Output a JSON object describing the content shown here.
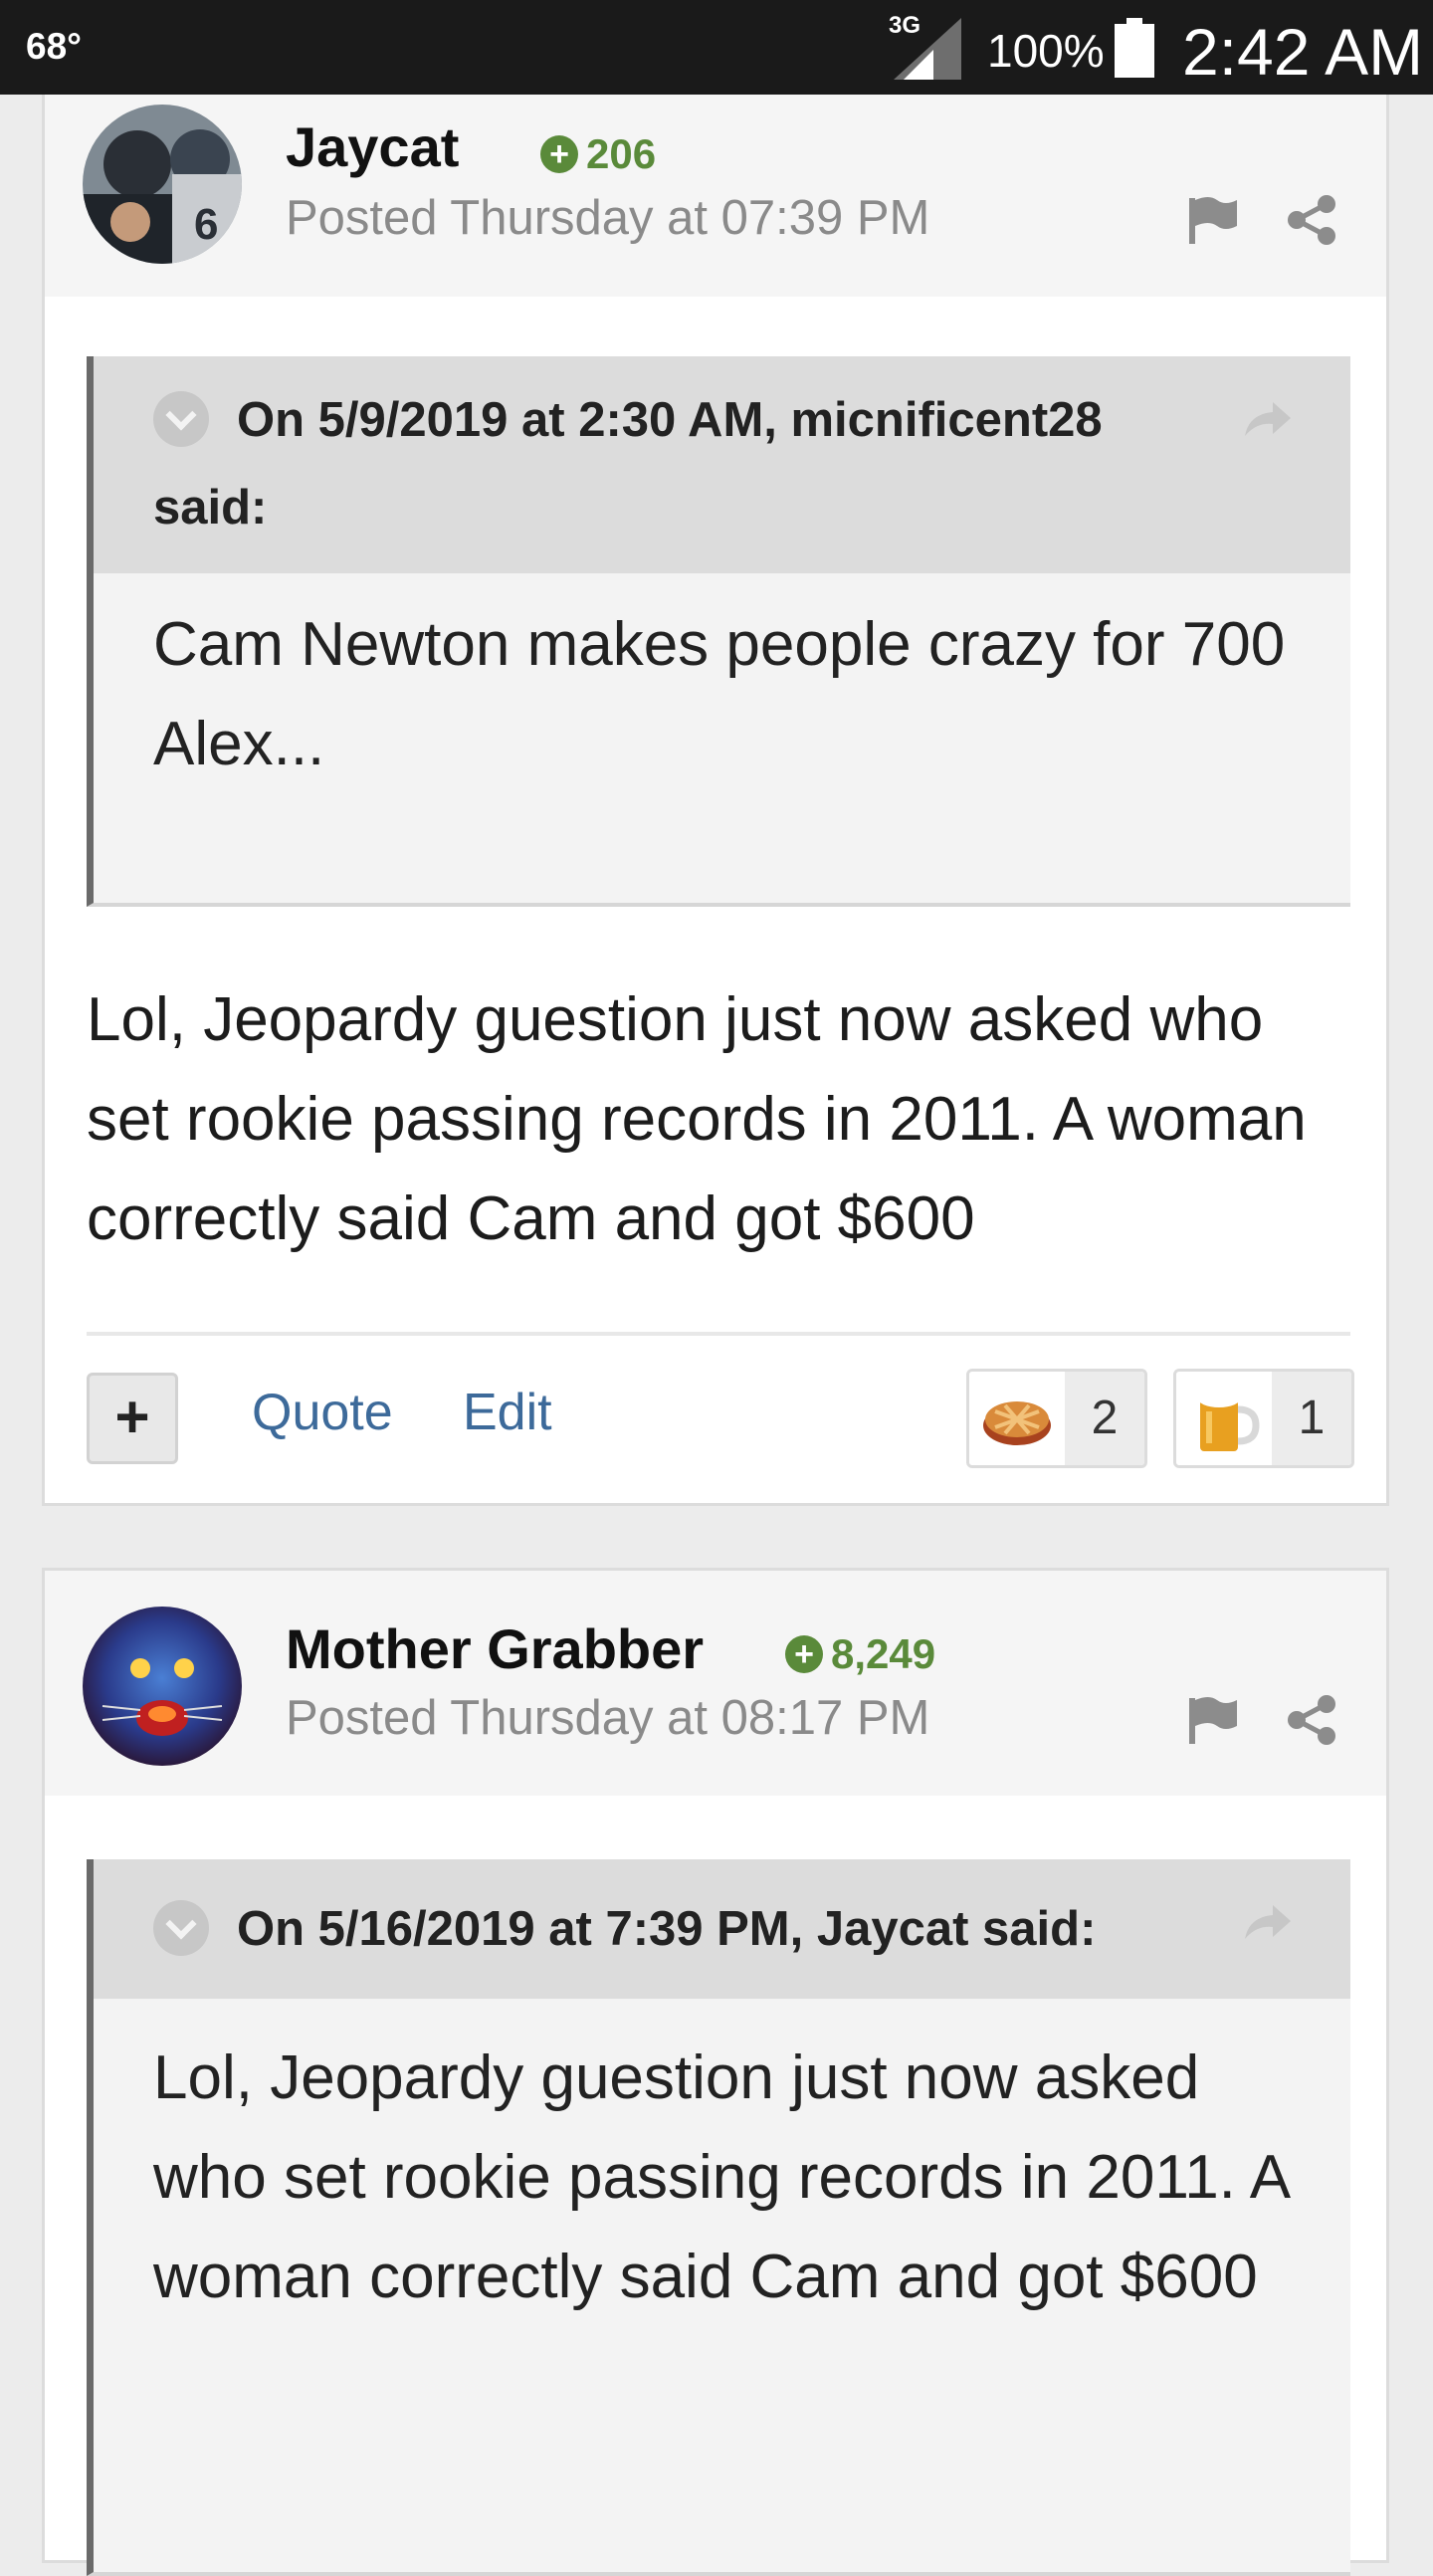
{
  "status_bar": {
    "temperature": "68°",
    "network": "3G",
    "battery": "100%",
    "time": "2:42 AM"
  },
  "posts": [
    {
      "author": "Jaycat",
      "reputation": "206",
      "posted": "Posted Thursday at 07:39 PM",
      "quote": {
        "header": "On 5/9/2019 at 2:30 AM, micnificent28",
        "said": "said:",
        "body": "Cam Newton makes people crazy for 700 Alex..."
      },
      "body": "Lol, Jeopardy guestion just now asked who set rookie passing records in 2011. A woman correctly said Cam and got $600",
      "actions": {
        "plus": "+",
        "quote": "Quote",
        "edit": "Edit"
      },
      "reactions": [
        {
          "icon": "pie-icon",
          "count": "2"
        },
        {
          "icon": "beer-icon",
          "count": "1"
        }
      ]
    },
    {
      "author": "Mother Grabber",
      "reputation": "8,249",
      "posted": "Posted Thursday at 08:17 PM",
      "quote": {
        "header": "On 5/16/2019 at 7:39 PM, Jaycat said:",
        "body": "Lol, Jeopardy guestion just now asked who set rookie passing records in 2011. A woman correctly said Cam and got $600"
      }
    }
  ],
  "colors": {
    "reputation": "#5a8a3a",
    "link": "#3d6a9a",
    "status_bar": "#1a1a1a"
  }
}
